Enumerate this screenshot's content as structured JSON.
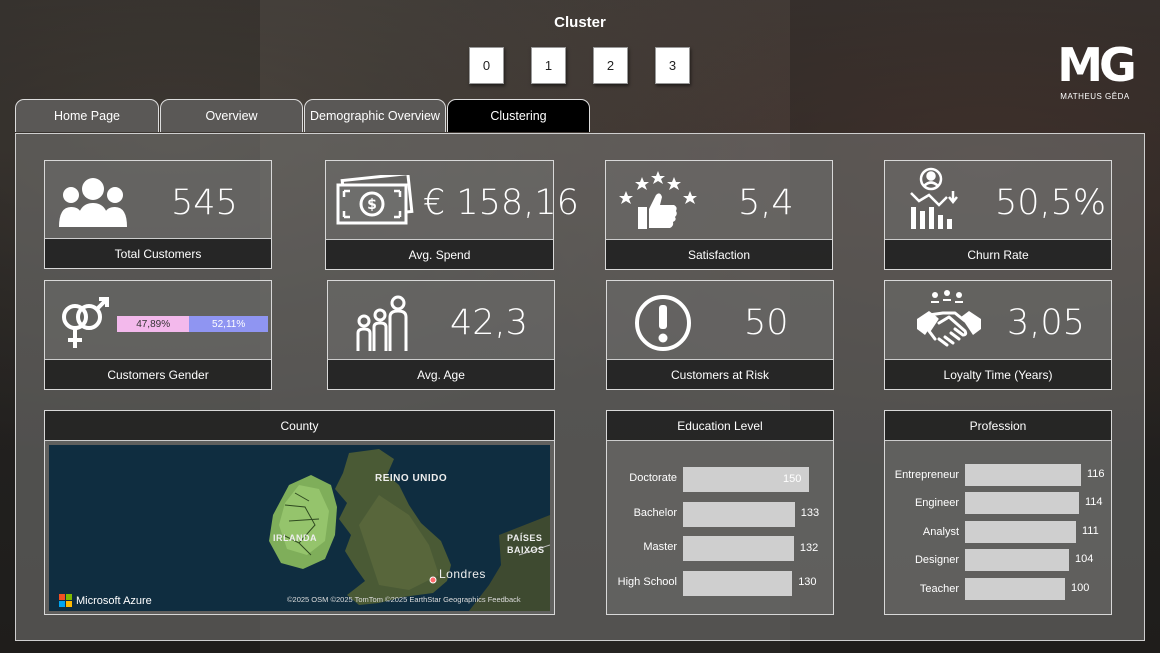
{
  "cluster": {
    "title": "Cluster",
    "options": [
      "0",
      "1",
      "2",
      "3"
    ]
  },
  "logo": {
    "mark": "MG",
    "name": "MATHEUS GÊDA"
  },
  "tabs": [
    {
      "label": "Home Page",
      "active": false
    },
    {
      "label": "Overview",
      "active": false
    },
    {
      "label": "Demographic Overview",
      "active": false
    },
    {
      "label": "Clustering",
      "active": true
    }
  ],
  "kpis": {
    "total_customers": {
      "value": "545",
      "label": "Total Customers",
      "icon": "group-icon"
    },
    "avg_spend": {
      "value": "€ 158,16",
      "label": "Avg. Spend",
      "icon": "money-icon"
    },
    "satisfaction": {
      "value": "5,4",
      "label": "Satisfaction",
      "icon": "thumbs-up-stars-icon"
    },
    "churn_rate": {
      "value": "50,5%",
      "label": "Churn Rate",
      "icon": "churn-chart-icon"
    },
    "customers_gender": {
      "label": "Customers Gender",
      "icon": "gender-icon",
      "female_pct": "47,89%",
      "male_pct": "52,11%",
      "female_share": 47.89,
      "male_share": 52.11
    },
    "avg_age": {
      "value": "42,3",
      "label": "Avg. Age",
      "icon": "family-icon"
    },
    "customers_at_risk": {
      "value": "50",
      "label": "Customers at Risk",
      "icon": "alert-icon"
    },
    "loyalty_time": {
      "value": "3,05",
      "label": "Loyalty Time (Years)",
      "icon": "handshake-icon"
    }
  },
  "county": {
    "title": "County",
    "labels": {
      "uk": "REINO UNIDO",
      "ireland": "IRLANDA",
      "netherlands_1": "PAÍSES",
      "netherlands_2": "BAIXOS",
      "london": "Londres"
    },
    "brand": "Microsoft Azure",
    "attribution": "©2025 OSM  ©2025 TomTom  ©2025 EarthStar Geographics  Feedback"
  },
  "chart_data": [
    {
      "type": "bar",
      "title": "Education Level",
      "categories": [
        "Doctorate",
        "Bachelor",
        "Master",
        "High School"
      ],
      "values": [
        150,
        133,
        132,
        130
      ],
      "value_labels": [
        "150",
        "133",
        "132",
        "130"
      ],
      "orientation": "horizontal",
      "color": "#cfcfcf"
    },
    {
      "type": "bar",
      "title": "Profession",
      "categories": [
        "Entrepreneur",
        "Engineer",
        "Analyst",
        "Designer",
        "Teacher"
      ],
      "values": [
        116,
        114,
        111,
        104,
        100
      ],
      "value_labels": [
        "116",
        "114",
        "111",
        "104",
        "100"
      ],
      "orientation": "horizontal",
      "color": "#cfcfcf"
    }
  ]
}
